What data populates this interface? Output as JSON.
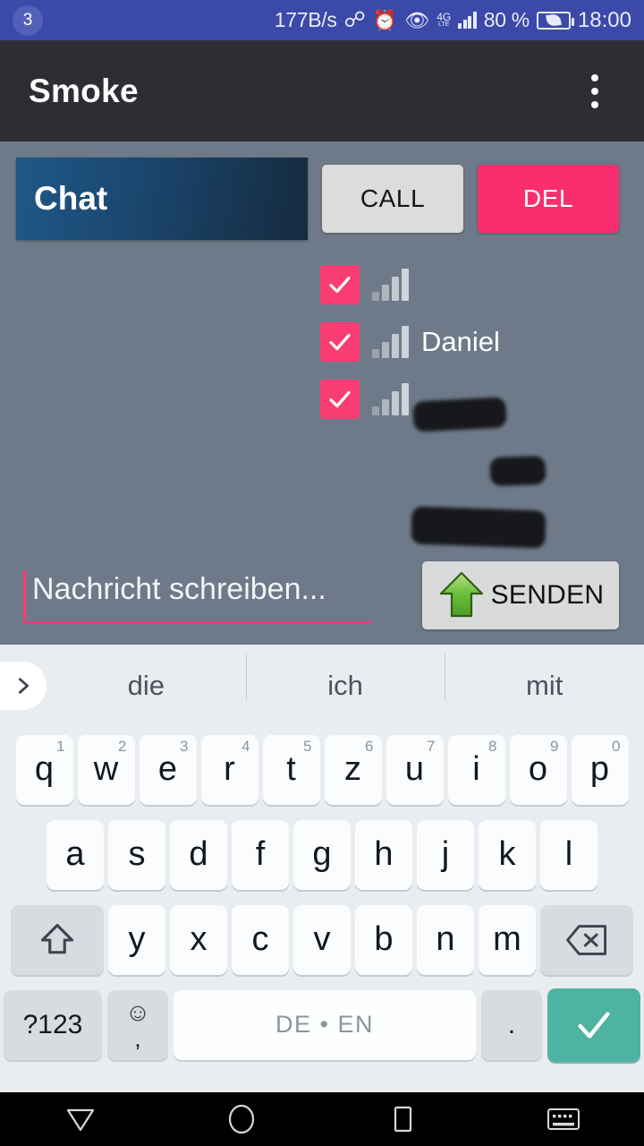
{
  "status_bar": {
    "notification_count": "3",
    "network_speed": "177B/s",
    "bluetooth_icon": "bluetooth-icon",
    "alarm_icon": "alarm-icon",
    "eye_icon": "eye-comfort-icon",
    "network_type": "4G",
    "network_type_sub": "LTE",
    "signal_icon": "signal-bars-icon",
    "battery_percent": "80 %",
    "battery_icon": "battery-icon",
    "time": "18:00",
    "background_color": "#3b4aa8"
  },
  "app_bar": {
    "title": "Smoke",
    "overflow_icon": "overflow-menu-icon",
    "background_color": "#2d2d33"
  },
  "main": {
    "background_color": "#6e7a89",
    "chat_banner_label": "Chat",
    "chat_banner_gradient_start": "#1e5987",
    "chat_banner_gradient_end": "#152a3e",
    "call_button_label": "CALL",
    "call_button_color": "#dcdcdc",
    "del_button_label": "DEL",
    "del_button_color": "#fa2e6e",
    "checkbox_color": "#fa3d72",
    "contacts": [
      {
        "name": "",
        "checked": true,
        "redacted": true,
        "signal_icon": "signal-bars-icon"
      },
      {
        "name": "Daniel",
        "checked": true,
        "redacted": true,
        "signal_icon": "signal-bars-icon"
      },
      {
        "name": "",
        "checked": true,
        "redacted": true,
        "signal_icon": "signal-bars-icon"
      }
    ],
    "message_placeholder": "Nachricht schreiben...",
    "message_value": "",
    "message_underline_color": "#e83a7c",
    "send_button_label": "SENDEN",
    "send_button_icon": "up-arrow-icon",
    "send_button_color": "#d9dada"
  },
  "keyboard": {
    "background_color": "#e9edf0",
    "expand_icon": "chevron-right-icon",
    "suggestions": [
      "die",
      "ich",
      "mit"
    ],
    "row1": [
      {
        "key": "q",
        "num": "1"
      },
      {
        "key": "w",
        "num": "2"
      },
      {
        "key": "e",
        "num": "3"
      },
      {
        "key": "r",
        "num": "4"
      },
      {
        "key": "t",
        "num": "5"
      },
      {
        "key": "z",
        "num": "6"
      },
      {
        "key": "u",
        "num": "7"
      },
      {
        "key": "i",
        "num": "8"
      },
      {
        "key": "o",
        "num": "9"
      },
      {
        "key": "p",
        "num": "0"
      }
    ],
    "row2": [
      {
        "key": "a"
      },
      {
        "key": "s"
      },
      {
        "key": "d"
      },
      {
        "key": "f"
      },
      {
        "key": "g"
      },
      {
        "key": "h"
      },
      {
        "key": "j"
      },
      {
        "key": "k"
      },
      {
        "key": "l"
      }
    ],
    "row3": [
      {
        "key": "y"
      },
      {
        "key": "x"
      },
      {
        "key": "c"
      },
      {
        "key": "v"
      },
      {
        "key": "b"
      },
      {
        "key": "n"
      },
      {
        "key": "m"
      }
    ],
    "shift_icon": "shift-icon",
    "backspace_icon": "backspace-icon",
    "symbols_label": "?123",
    "emoji_icon": "emoji-icon",
    "comma_label": ",",
    "space_label": "DE • EN",
    "period_label": ".",
    "enter_icon": "check-icon",
    "enter_color": "#4fb3a3"
  },
  "nav_bar": {
    "back_icon": "back-triangle-icon",
    "home_icon": "home-circle-icon",
    "recents_icon": "recents-square-icon",
    "hide_keyboard_icon": "hide-keyboard-icon",
    "background_color": "#000000"
  }
}
